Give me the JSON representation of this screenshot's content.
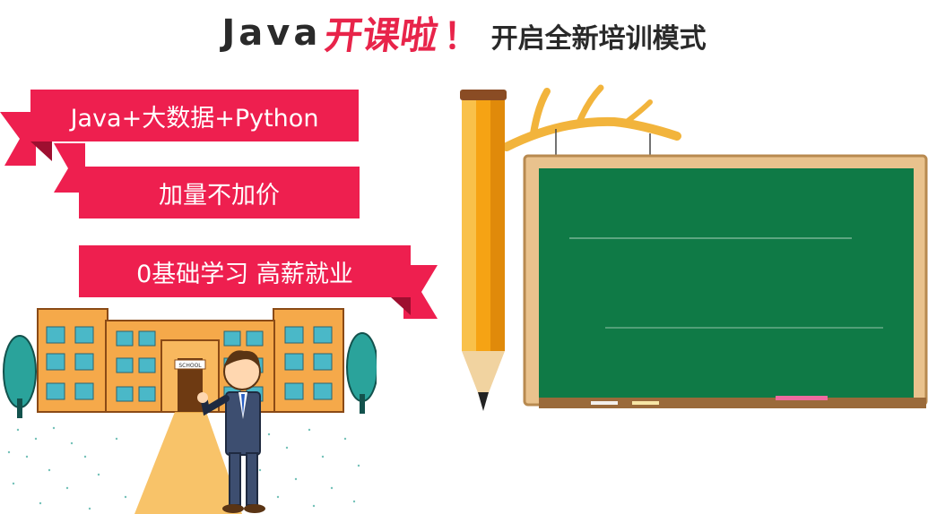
{
  "headline": {
    "part1": "Java",
    "part2": "开课啦",
    "part3": "！",
    "part4": "开启全新培训模式"
  },
  "ribbons": [
    {
      "label": "Java+大数据+Python"
    },
    {
      "label": "加量不加价"
    },
    {
      "label": "0基础学习 高薪就业"
    }
  ],
  "school": {
    "sign": "SCHOOL"
  },
  "colors": {
    "ribbon": "#ee1f4f",
    "ribbon_fold": "#b21337",
    "headline_accent": "#e8244a",
    "headline_text": "#2a2a2a",
    "chalkboard": "#0f7a46",
    "frame": "#e9c28d",
    "pencil": "#f6a314"
  }
}
